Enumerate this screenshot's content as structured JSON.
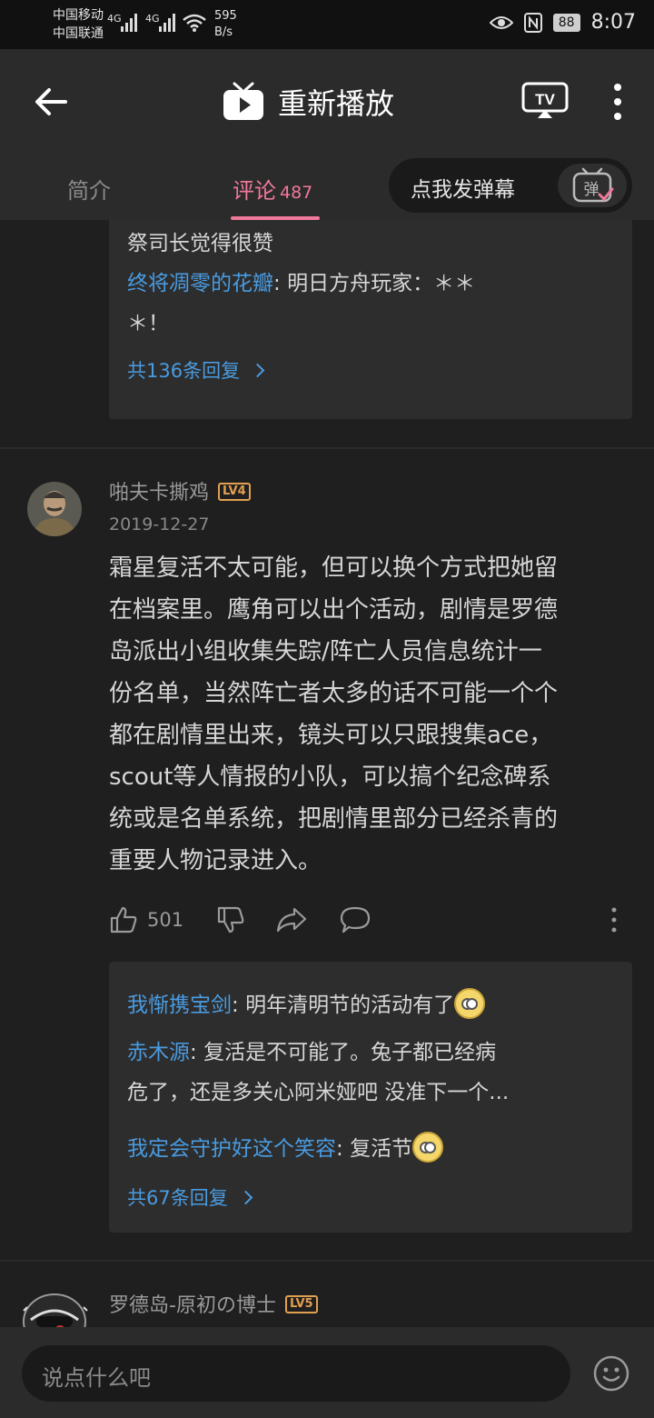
{
  "status_bar": {
    "carrier_1": "中国移动",
    "carrier_2": "中国联通",
    "net_1": "4G",
    "net_2": "4G",
    "speed_value": "595",
    "speed_unit": "B/s",
    "battery": "88",
    "time": "8:07"
  },
  "header": {
    "title": "重新播放"
  },
  "tabs": {
    "intro": "简介",
    "comments": "评论",
    "comments_count": "487",
    "danmaku_button": "点我发弹幕",
    "danmaku_icon_char": "弹"
  },
  "prev_reply_box": {
    "partial_text": "祭司长觉得很赞",
    "reply_user": "终将凋零的花瓣",
    "reply_text_1": "明日方舟玩家：＊＊",
    "reply_text_2": "＊！",
    "more": "共136条回复"
  },
  "comment": {
    "username": "啪夫卡撕鸡",
    "level": "LV4",
    "date": "2019-12-27",
    "lines": [
      "霜星复活不太可能，但可以换个方式把她留",
      "在档案里。鹰角可以出个活动，剧情是罗德",
      "岛派出小组收集失踪/阵亡人员信息统计一",
      "份名单，当然阵亡者太多的话不可能一个个",
      "都在剧情里出来，镜头可以只跟搜集ace，",
      "scout等人情报的小队，可以搞个纪念碑系",
      "统或是名单系统，把剧情里部分已经杀青的",
      "重要人物记录进入。"
    ],
    "likes": "501",
    "replies": [
      {
        "user": "我惭携宝剑",
        "text": "明年清明节的活动有了"
      },
      {
        "user": "赤木源",
        "text": "复活是不可能了。兔子都已经病",
        "text2": "危了，还是多关心阿米娅吧 没准下一个..."
      },
      {
        "user": "我定会守护好这个笑容",
        "text": "复活节"
      }
    ],
    "more": "共67条回复"
  },
  "next_comment": {
    "username": "罗德岛-原初の博士",
    "level": "LV5"
  },
  "bottom": {
    "placeholder": "说点什么吧"
  },
  "colors": {
    "accent": "#f0789a",
    "link": "#4a9be0",
    "level": "#e0a050"
  }
}
